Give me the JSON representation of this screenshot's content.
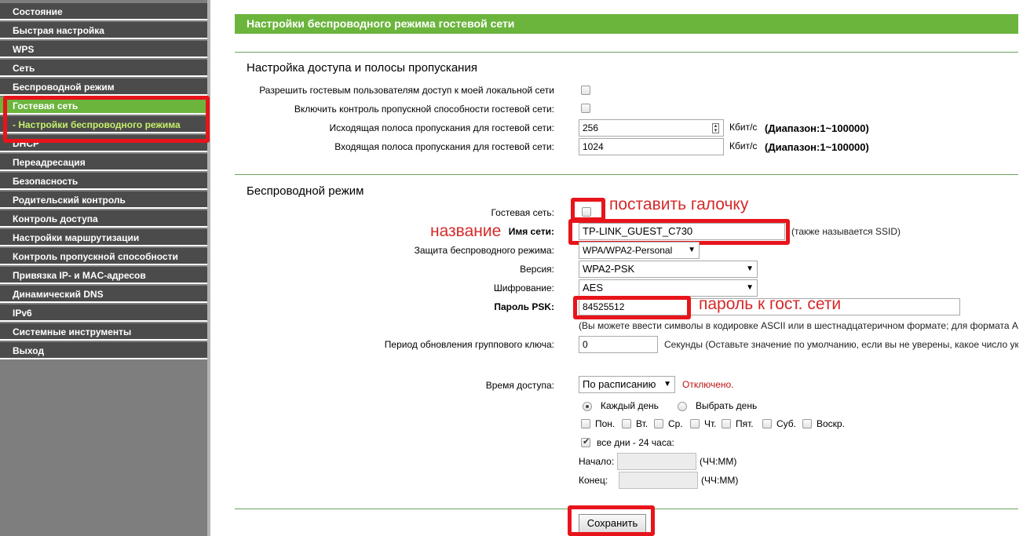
{
  "sidebar": {
    "items": [
      {
        "label": "Состояние",
        "state": "normal"
      },
      {
        "label": "Быстрая настройка",
        "state": "normal"
      },
      {
        "label": "WPS",
        "state": "normal"
      },
      {
        "label": "Сеть",
        "state": "normal"
      },
      {
        "label": "Беспроводной режим",
        "state": "normal"
      },
      {
        "label": "Гостевая сеть",
        "state": "active"
      },
      {
        "label": "- Настройки беспроводного режима",
        "state": "sub"
      },
      {
        "label": "DHCP",
        "state": "normal"
      },
      {
        "label": "Переадресация",
        "state": "normal"
      },
      {
        "label": "Безопасность",
        "state": "normal"
      },
      {
        "label": "Родительский контроль",
        "state": "normal"
      },
      {
        "label": "Контроль доступа",
        "state": "normal"
      },
      {
        "label": "Настройки маршрутизации",
        "state": "normal"
      },
      {
        "label": "Контроль пропускной способности",
        "state": "normal"
      },
      {
        "label": "Привязка IP- и MAC-адресов",
        "state": "normal"
      },
      {
        "label": "Динамический DNS",
        "state": "normal"
      },
      {
        "label": "IPv6",
        "state": "normal"
      },
      {
        "label": "Системные инструменты",
        "state": "normal"
      },
      {
        "label": "Выход",
        "state": "normal"
      }
    ]
  },
  "page": {
    "title": "Настройки беспроводного режима гостевой сети"
  },
  "bandwidth": {
    "title": "Настройка доступа и полосы пропускания",
    "allow_local_label": "Разрешить гостевым пользователям доступ к моей локальной сети",
    "allow_local_checked": false,
    "bw_control_label": "Включить контроль пропускной способности гостевой сети:",
    "bw_control_checked": false,
    "egress_label": "Исходящая полоса пропускания для гостевой сети:",
    "egress_value": "256",
    "ingress_label": "Входящая полоса пропускания для гостевой сети:",
    "ingress_value": "1024",
    "unit": "Кбит/с",
    "range": "(Диапазон:1~100000)"
  },
  "wireless": {
    "title": "Беспроводной режим",
    "guest_label": "Гостевая сеть:",
    "guest_checked": false,
    "ssid_label": "Имя сети:",
    "ssid_value": "TP-LINK_GUEST_C730",
    "ssid_hint": "(также называется SSID)",
    "security_label": "Защита беспроводного режима:",
    "security_value": "WPA/WPA2-Personal",
    "version_label": "Версия:",
    "version_value": "WPA2-PSK",
    "encryption_label": "Шифрование:",
    "encryption_value": "AES",
    "psk_label": "Пароль PSK:",
    "psk_value": "84525512",
    "psk_hint": "(Вы можете ввести символы в кодировке ASCII или в шестнадцатеричном формате; для формата A",
    "rekey_label": "Период обновления группового ключа:",
    "rekey_value": "0",
    "rekey_hint": "Секунды (Оставьте значение по умолчанию, если вы не уверены, какое число ук",
    "access_time_label": "Время доступа:",
    "access_time_value": "По расписанию",
    "access_time_status": "Отключено.",
    "every_day_label": "Каждый день",
    "choose_day_label": "Выбрать день",
    "days": [
      "Пон.",
      "Вт.",
      "Ср.",
      "Чт.",
      "Пят.",
      "Суб.",
      "Воскр."
    ],
    "all_day_label": "все дни - 24 часа:",
    "all_day_checked": true,
    "start_label": "Начало:",
    "end_label": "Конец:",
    "time_format": "(ЧЧ:ММ)"
  },
  "annotations": {
    "checkbox_note": "поставить галочку",
    "name_note": "название",
    "password_note": "пароль к гост. сети"
  },
  "actions": {
    "save_label": "Сохранить"
  },
  "colors": {
    "accent_green": "#6bb53d",
    "sidebar_item": "#4b4b4b",
    "annotation_red": "#e8141b"
  }
}
